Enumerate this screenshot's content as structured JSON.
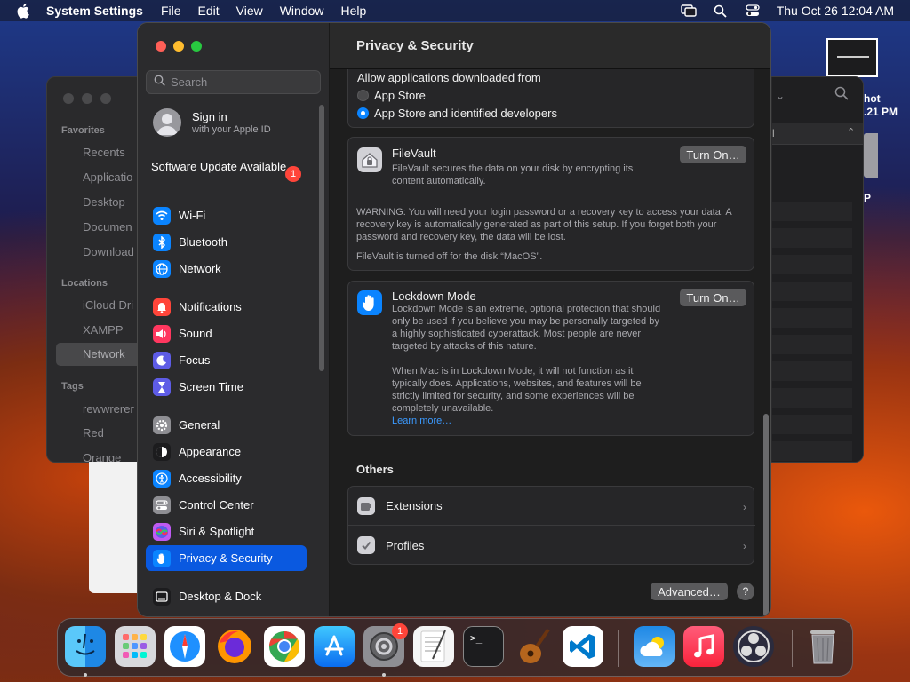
{
  "menubar": {
    "app_name": "System Settings",
    "menus": [
      "File",
      "Edit",
      "View",
      "Window",
      "Help"
    ],
    "datetime": "Thu Oct 26  12:04 AM"
  },
  "desktop": {
    "screenshot_label_line1": "hot",
    "screenshot_label_line2": ".21 PM",
    "drive_label": "P"
  },
  "finder": {
    "favorites_header": "Favorites",
    "favorites": [
      "Recents",
      "Applicatio",
      "Desktop",
      "Documen",
      "Download"
    ],
    "locations_header": "Locations",
    "locations": [
      "iCloud Dri",
      "XAMPP",
      "Network"
    ],
    "tags_header": "Tags",
    "tags": [
      "rewwrerer",
      "Red",
      "Orange"
    ],
    "column_char": "l"
  },
  "sidebar": {
    "search_placeholder": "Search",
    "account_title": "Sign in",
    "account_subtitle": "with your Apple ID",
    "software_update": "Software Update Available",
    "software_update_badge": "1",
    "items": [
      {
        "label": "Wi-Fi",
        "icon": "wifi-icon",
        "color": "#0a84ff"
      },
      {
        "label": "Bluetooth",
        "icon": "bluetooth-icon",
        "color": "#0a84ff"
      },
      {
        "label": "Network",
        "icon": "globe-icon",
        "color": "#0a84ff"
      },
      {
        "label": "Notifications",
        "icon": "bell-icon",
        "color": "#ff453a"
      },
      {
        "label": "Sound",
        "icon": "speaker-icon",
        "color": "#ff375f"
      },
      {
        "label": "Focus",
        "icon": "moon-icon",
        "color": "#5e5ce6"
      },
      {
        "label": "Screen Time",
        "icon": "hourglass-icon",
        "color": "#5e5ce6"
      },
      {
        "label": "General",
        "icon": "gear-icon",
        "color": "#8e8e93"
      },
      {
        "label": "Appearance",
        "icon": "appearance-icon",
        "color": "#1c1c1e"
      },
      {
        "label": "Accessibility",
        "icon": "accessibility-icon",
        "color": "#0a84ff"
      },
      {
        "label": "Control Center",
        "icon": "control-center-icon",
        "color": "#8e8e93"
      },
      {
        "label": "Siri & Spotlight",
        "icon": "siri-icon",
        "color": "#bf5af2"
      },
      {
        "label": "Privacy & Security",
        "icon": "hand-icon",
        "color": "#0a84ff"
      },
      {
        "label": "Desktop & Dock",
        "icon": "dock-icon",
        "color": "#1c1c1e"
      }
    ]
  },
  "content": {
    "title": "Privacy & Security",
    "allow_label": "Allow applications downloaded from",
    "allow_options": [
      "App Store",
      "App Store and identified developers"
    ],
    "allow_selected": 1,
    "filevault": {
      "title": "FileVault",
      "desc": "FileVault secures the data on your disk by encrypting its content automatically.",
      "warning": "WARNING: You will need your login password or a recovery key to access your data. A recovery key is automatically generated as part of this setup. If you forget both your password and recovery key, the data will be lost.",
      "status": "FileVault is turned off for the disk “MacOS”.",
      "button": "Turn On…"
    },
    "lockdown": {
      "title": "Lockdown Mode",
      "desc": "Lockdown Mode is an extreme, optional protection that should only be used if you believe you may be personally targeted by a highly sophisticated cyberattack. Most people are never targeted by attacks of this nature.",
      "desc2": "When Mac is in Lockdown Mode, it will not function as it typically does. Applications, websites, and features will be strictly limited for security, and some experiences will be completely unavailable.",
      "learn_more": "Learn more…",
      "button": "Turn On…"
    },
    "others_header": "Others",
    "others": [
      "Extensions",
      "Profiles"
    ],
    "advanced_button": "Advanced…",
    "help_button": "?"
  },
  "dock": {
    "apps": [
      "Finder",
      "Launchpad",
      "Safari",
      "Firefox",
      "Chrome",
      "App Store",
      "System Settings",
      "TextEdit",
      "Terminal",
      "GarageBand",
      "Visual Studio Code",
      "Weather",
      "Music",
      "OBS",
      "Trash"
    ],
    "settings_badge": "1"
  }
}
